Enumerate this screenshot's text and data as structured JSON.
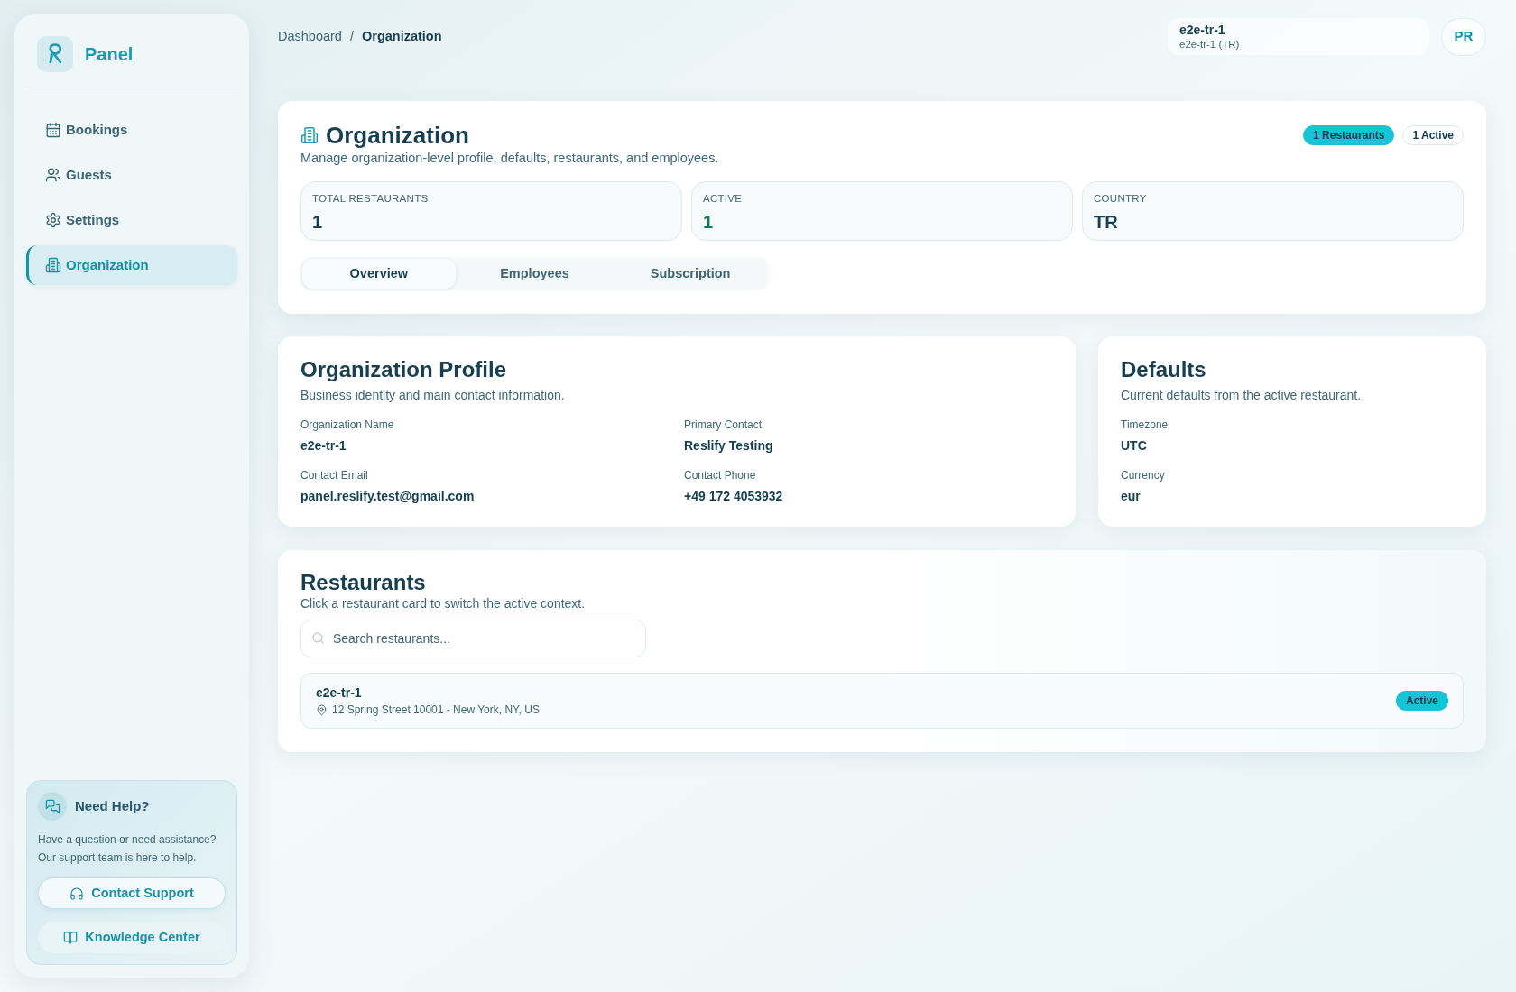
{
  "sidebar": {
    "brand": "Panel",
    "items": [
      {
        "label": "Bookings",
        "selected": false
      },
      {
        "label": "Guests",
        "selected": false
      },
      {
        "label": "Settings",
        "selected": false
      },
      {
        "label": "Organization",
        "selected": true
      }
    ],
    "help": {
      "title": "Need Help?",
      "lines": [
        "Have a question or need assistance?",
        "Our support team is here to help."
      ],
      "buttons": [
        {
          "label": "Contact Support",
          "kind": "outlined"
        },
        {
          "label": "Knowledge Center",
          "kind": "soft"
        }
      ]
    }
  },
  "breadcrumb": {
    "separator": "/",
    "items": [
      {
        "label": "Dashboard",
        "current": false
      },
      {
        "label": "Organization",
        "current": true
      }
    ]
  },
  "context_switcher": {
    "name": "e2e-tr-1",
    "detail": "e2e-tr-1 (TR)"
  },
  "avatar": {
    "initials": "PR"
  },
  "organization": {
    "title": "Organization",
    "subtitle": "Manage organization-level profile, defaults, restaurants, and employees.",
    "badges": [
      {
        "label": "1 Restaurants",
        "kind": "filled"
      },
      {
        "label": "1 Active",
        "kind": "outlined"
      }
    ],
    "stats": [
      {
        "label": "TOTAL RESTAURANTS",
        "value": "1",
        "kind": "plain"
      },
      {
        "label": "ACTIVE",
        "value": "1",
        "kind": "positive"
      },
      {
        "label": "COUNTRY",
        "value": "TR",
        "kind": "plain"
      }
    ],
    "tabs": [
      {
        "label": "Overview",
        "selected": true
      },
      {
        "label": "Employees",
        "selected": false
      },
      {
        "label": "Subscription",
        "selected": false
      }
    ]
  },
  "profile": {
    "title": "Organization Profile",
    "subtitle": "Business identity and main contact information.",
    "fields": [
      {
        "label": "Organization Name",
        "value": "e2e-tr-1"
      },
      {
        "label": "Primary Contact",
        "value": "Reslify Testing"
      },
      {
        "label": "Contact Email",
        "value": "panel.reslify.test@gmail.com"
      },
      {
        "label": "Contact Phone",
        "value": "+49 172 4053932"
      }
    ]
  },
  "defaults": {
    "title": "Defaults",
    "subtitle": "Current defaults from the active restaurant.",
    "fields": [
      {
        "label": "Timezone",
        "value": "UTC"
      },
      {
        "label": "Currency",
        "value": "eur"
      }
    ]
  },
  "restaurants": {
    "title": "Restaurants",
    "subtitle": "Click a restaurant card to switch the active context.",
    "search": {
      "placeholder": "Search restaurants..."
    },
    "items": [
      {
        "name": "e2e-tr-1",
        "address": "12 Spring Street 10001 - New York, NY, US",
        "badge": "Active"
      }
    ]
  }
}
